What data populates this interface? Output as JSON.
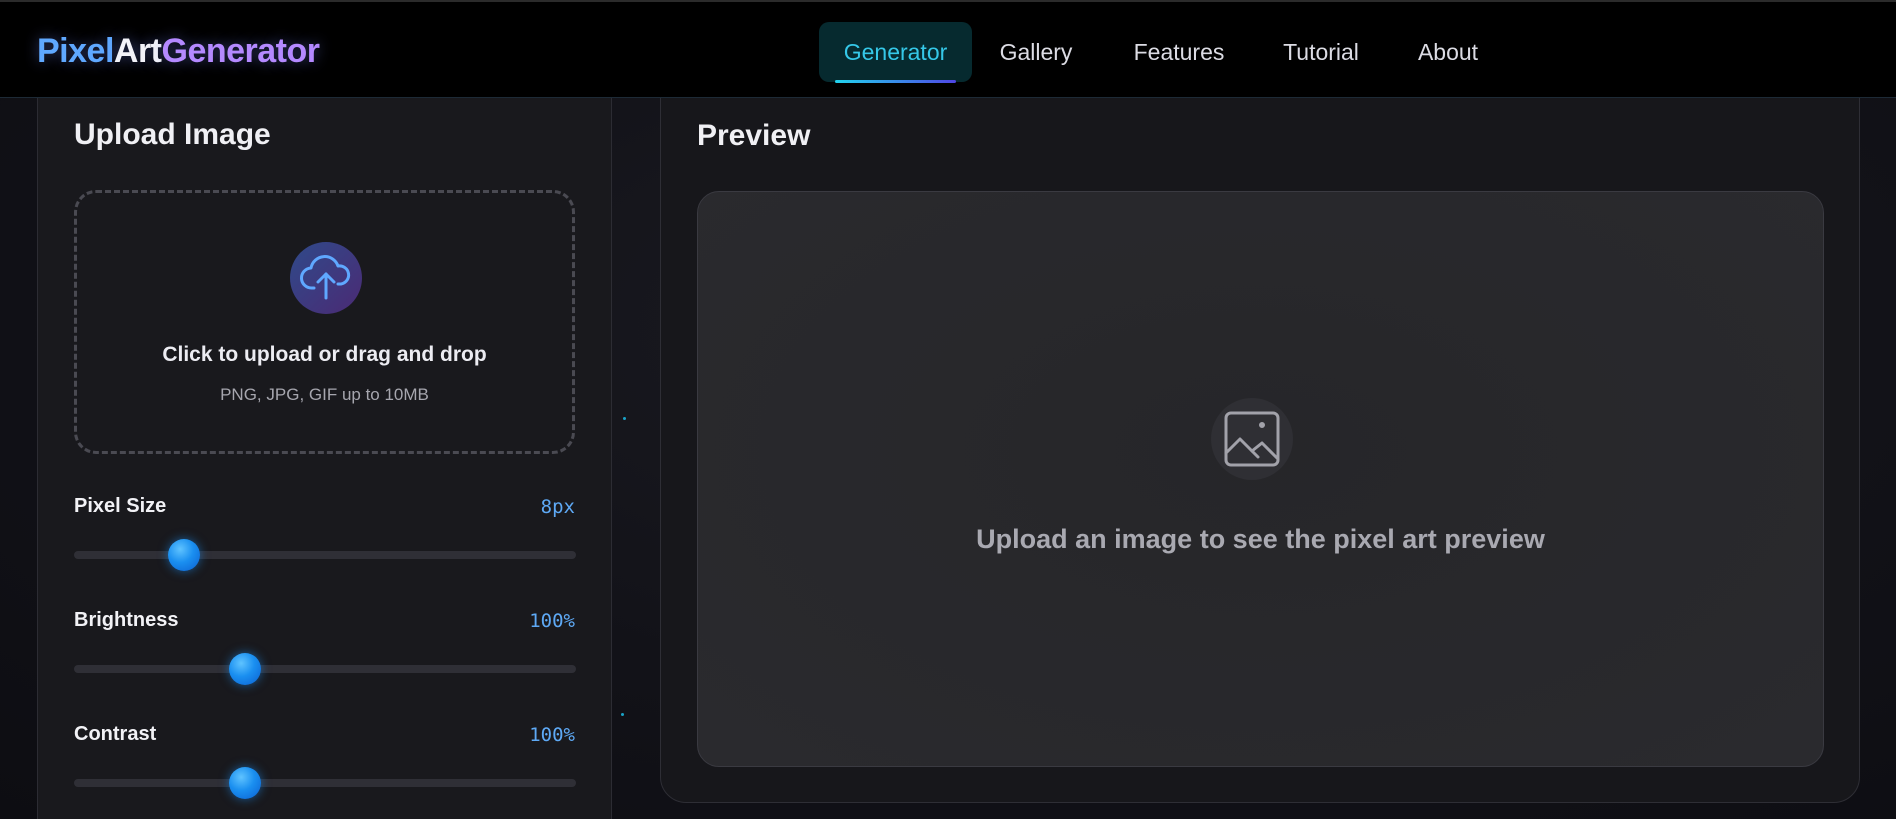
{
  "logo": {
    "part1": "Pixel",
    "part2": "Art",
    "part3": "Generator"
  },
  "nav": {
    "items": [
      {
        "label": "Generator",
        "active": true
      },
      {
        "label": "Gallery",
        "active": false
      },
      {
        "label": "Features",
        "active": false
      },
      {
        "label": "Tutorial",
        "active": false
      },
      {
        "label": "About",
        "active": false
      }
    ]
  },
  "upload": {
    "title": "Upload Image",
    "dropzone_title": "Click to upload or drag and drop",
    "dropzone_subtitle": "PNG, JPG, GIF up to 10MB",
    "icon": "cloud-upload-icon"
  },
  "sliders": [
    {
      "label": "Pixel Size",
      "value_text": "8px",
      "fraction": 0.22
    },
    {
      "label": "Brightness",
      "value_text": "100%",
      "fraction": 0.34
    },
    {
      "label": "Contrast",
      "value_text": "100%",
      "fraction": 0.34
    }
  ],
  "preview": {
    "title": "Preview",
    "empty_message": "Upload an image to see the pixel art preview",
    "icon": "image-icon"
  },
  "colors": {
    "accent_cyan": "#35c8e8",
    "accent_blue": "#5ea9f5",
    "logo_blue": "#5fa8ff",
    "logo_purple": "#b489ff",
    "panel_bg": "#19191d"
  }
}
